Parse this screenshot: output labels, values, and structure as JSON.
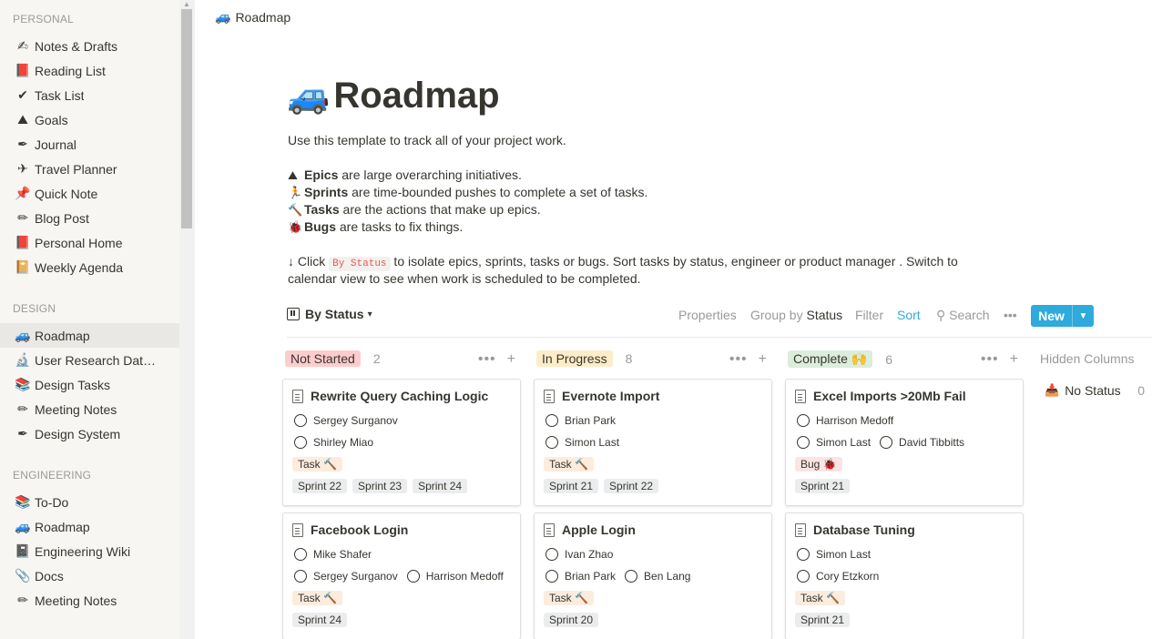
{
  "sidebar": {
    "sections": [
      {
        "title": "PERSONAL",
        "items": [
          {
            "icon": "✍",
            "label": "Notes & Drafts"
          },
          {
            "icon": "📕",
            "label": "Reading List"
          },
          {
            "icon": "✔",
            "label": "Task List"
          },
          {
            "icon": "⛰",
            "label": "Goals"
          },
          {
            "icon": "✒",
            "label": "Journal"
          },
          {
            "icon": "✈",
            "label": "Travel Planner"
          },
          {
            "icon": "📌",
            "label": "Quick Note"
          },
          {
            "icon": "✏",
            "label": "Blog Post"
          },
          {
            "icon": "📕",
            "label": "Personal Home"
          },
          {
            "icon": "📔",
            "label": "Weekly Agenda"
          }
        ]
      },
      {
        "title": "DESIGN",
        "items": [
          {
            "icon": "🚙",
            "label": "Roadmap"
          },
          {
            "icon": "🔬",
            "label": "User Research Datab..."
          },
          {
            "icon": "📚",
            "label": "Design Tasks"
          },
          {
            "icon": "✏",
            "label": "Meeting Notes"
          },
          {
            "icon": "✒",
            "label": "Design System"
          }
        ]
      },
      {
        "title": "ENGINEERING",
        "items": [
          {
            "icon": "📚",
            "label": "To-Do"
          },
          {
            "icon": "🚙",
            "label": "Roadmap"
          },
          {
            "icon": "📓",
            "label": "Engineering Wiki"
          },
          {
            "icon": "📎",
            "label": "Docs"
          },
          {
            "icon": "✏",
            "label": "Meeting Notes"
          }
        ]
      }
    ]
  },
  "breadcrumb": {
    "icon": "🚙",
    "label": "Roadmap"
  },
  "page": {
    "icon": "🚙",
    "title": "Roadmap",
    "intro": "Use this template to track all of your project work.",
    "bullets": [
      {
        "icon": "⛰",
        "term": "Epics",
        "text": " are large overarching initiatives."
      },
      {
        "icon": "🏃",
        "term": "Sprints",
        "text": " are time-bounded pushes to complete a set of tasks."
      },
      {
        "icon": "🔨",
        "term": "Tasks",
        "text": " are the actions that make up epics."
      },
      {
        "icon": "🐞",
        "term": "Bugs",
        "text": " are tasks to fix things."
      }
    ],
    "hint_prefix": "↓ Click ",
    "hint_code": "By Status",
    "hint_line1": " to isolate epics, sprints, tasks or bugs. Sort tasks by status, engineer or product manager . Switch to",
    "hint_line2": "calendar view to see when work is scheduled to be completed."
  },
  "toolbar": {
    "view_label": "By Status",
    "properties": "Properties",
    "group_by": "Group by",
    "group_value": "Status",
    "filter": "Filter",
    "sort": "Sort",
    "search": "Search",
    "more": "•••",
    "new_label": "New"
  },
  "board": {
    "columns": [
      {
        "label": "Not Started",
        "count": "2",
        "color": "#ffcccc",
        "cards": [
          {
            "title": "Rewrite Query Caching Logic",
            "people": [
              [
                "Sergey Surganov"
              ],
              [
                "Shirley Miao"
              ]
            ],
            "type": "Task 🔨",
            "type_kind": "task",
            "sprints": [
              "Sprint 22",
              "Sprint 23",
              "Sprint 24"
            ]
          },
          {
            "title": "Facebook Login",
            "people": [
              [
                "Mike Shafer"
              ],
              [
                "Sergey Surganov",
                "Harrison Medoff"
              ]
            ],
            "type": "Task 🔨",
            "type_kind": "task",
            "sprints": [
              "Sprint 24"
            ]
          }
        ]
      },
      {
        "label": "In Progress",
        "count": "8",
        "color": "#fdecc8",
        "cards": [
          {
            "title": "Evernote Import",
            "people": [
              [
                "Brian Park"
              ],
              [
                "Simon Last"
              ]
            ],
            "type": "Task 🔨",
            "type_kind": "task",
            "sprints": [
              "Sprint 21",
              "Sprint 22"
            ]
          },
          {
            "title": "Apple Login",
            "people": [
              [
                "Ivan Zhao"
              ],
              [
                "Brian Park",
                "Ben Lang"
              ]
            ],
            "type": "Task 🔨",
            "type_kind": "task",
            "sprints": [
              "Sprint 20"
            ]
          }
        ]
      },
      {
        "label": "Complete 🙌",
        "count": "6",
        "color": "#dbeddb",
        "cards": [
          {
            "title": "Excel Imports >20Mb Fail",
            "people": [
              [
                "Harrison Medoff"
              ],
              [
                "Simon Last",
                "David Tibbitts"
              ]
            ],
            "type": "Bug 🐞",
            "type_kind": "bug",
            "sprints": [
              "Sprint 21"
            ]
          },
          {
            "title": "Database Tuning",
            "people": [
              [
                "Simon Last"
              ],
              [
                "Cory Etzkorn"
              ]
            ],
            "type": "Task 🔨",
            "type_kind": "task",
            "sprints": [
              "Sprint 21"
            ]
          }
        ]
      }
    ],
    "hidden_columns": "Hidden Columns",
    "no_status": {
      "icon": "📥",
      "label": "No Status",
      "count": "0"
    }
  }
}
